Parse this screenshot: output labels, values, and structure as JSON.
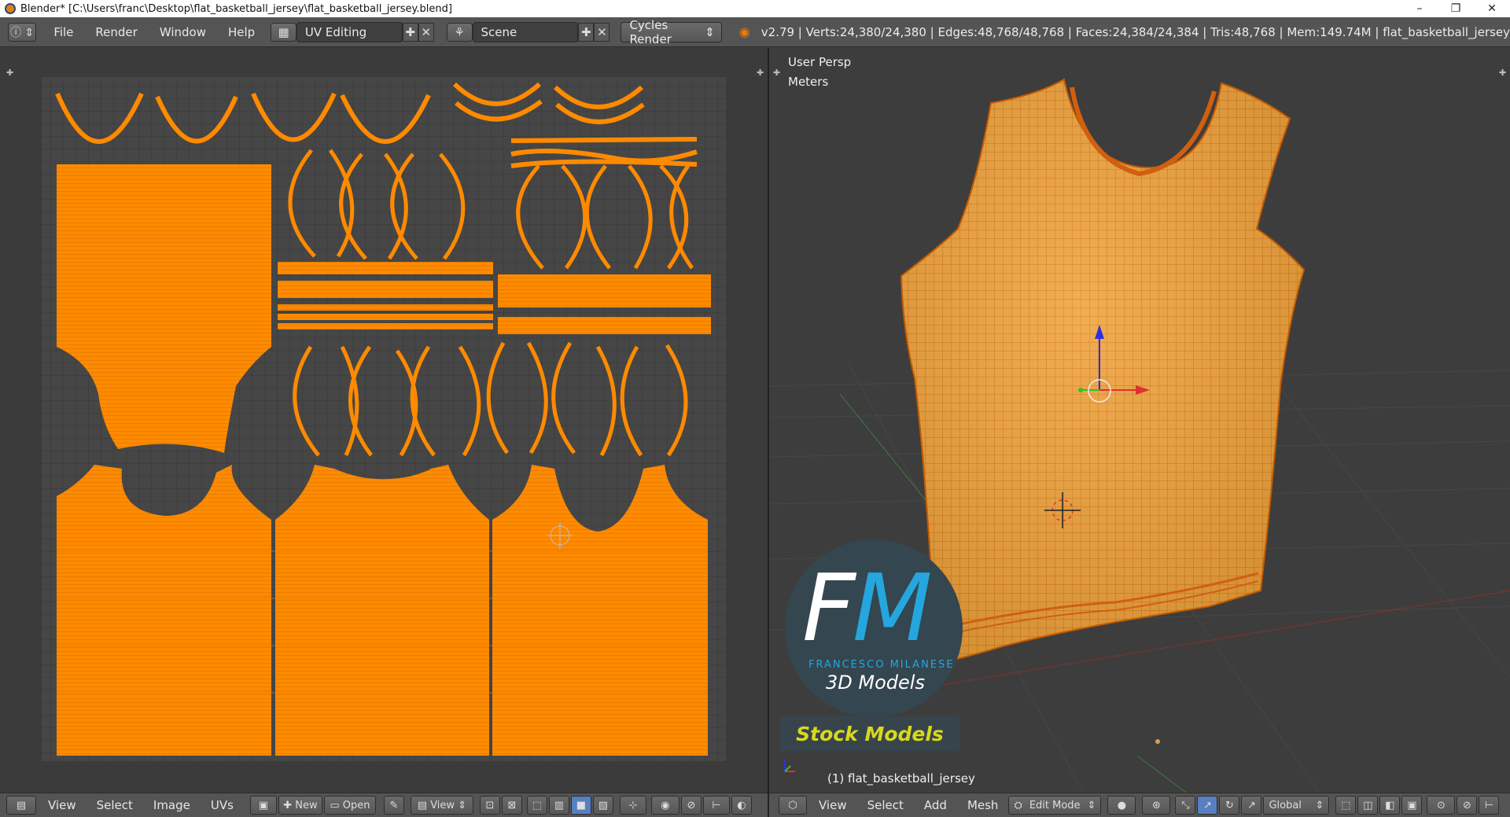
{
  "window": {
    "title": "Blender* [C:\\Users\\franc\\Desktop\\flat_basketball_jersey\\flat_basketball_jersey.blend]",
    "controls": [
      "–",
      "❐",
      "✕"
    ]
  },
  "infobar": {
    "menus": [
      "File",
      "Render",
      "Window",
      "Help"
    ],
    "layout": "UV Editing",
    "scene": "Scene",
    "engine": "Cycles Render",
    "stats": "v2.79 | Verts:24,380/24,380 | Edges:48,768/48,768 | Faces:24,384/24,384 | Tris:48,768 | Mem:149.74M | flat_basketball_jersey"
  },
  "uv_editor": {
    "menus": [
      "View",
      "Select",
      "Image",
      "UVs"
    ],
    "new_label": "New",
    "open_label": "Open",
    "view_label": "View"
  },
  "viewport": {
    "persp": "User Persp",
    "units": "Meters",
    "object": "(1) flat_basketball_jersey",
    "menus": [
      "View",
      "Select",
      "Add",
      "Mesh"
    ],
    "mode": "Edit Mode",
    "orientation": "Global"
  },
  "logo": {
    "f": "F",
    "m": "M",
    "name": "FRANCESCO MILANESE",
    "sub": "3D Models",
    "stock": "Stock Models"
  },
  "colors": {
    "uv_orange": "#ff8a00",
    "mesh_orange": "#f2a23a",
    "wire": "#d96a00",
    "grid_bg": "#444444",
    "panel": "#545454"
  }
}
